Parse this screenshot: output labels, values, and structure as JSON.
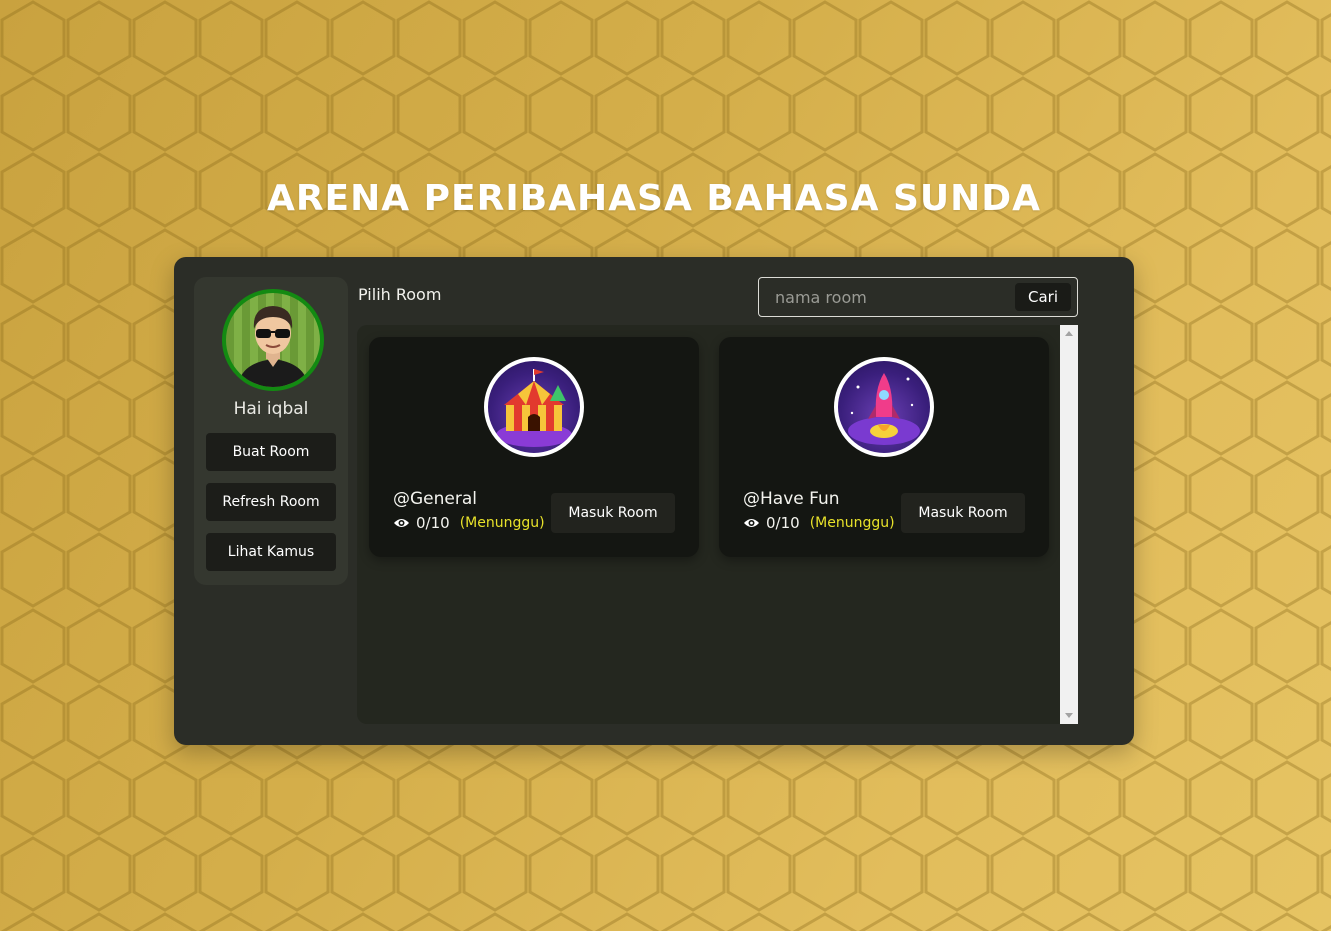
{
  "page": {
    "title": "ARENA PERIBAHASA BAHASA SUNDA"
  },
  "sidebar": {
    "greeting": "Hai iqbal",
    "avatar_icon": "user-avatar-icon",
    "buttons": [
      {
        "label": "Buat Room"
      },
      {
        "label": "Refresh Room"
      },
      {
        "label": "Lihat Kamus"
      }
    ]
  },
  "rooms_header": {
    "label": "Pilih Room"
  },
  "search": {
    "placeholder": "nama room",
    "value": "",
    "button_label": "Cari"
  },
  "rooms": [
    {
      "name": "@General",
      "players": "0/10",
      "status": "(Menunggu)",
      "button_label": "Masuk Room",
      "image_icon": "circus-tent-icon"
    },
    {
      "name": "@Have Fun",
      "players": "0/10",
      "status": "(Menunggu)",
      "button_label": "Masuk Room",
      "image_icon": "rocket-icon"
    }
  ],
  "colors": {
    "accent_status": "#e8e22a",
    "panel_bg": "#2b2d27",
    "card_bg": "#141612",
    "avatar_border": "#138a12"
  }
}
